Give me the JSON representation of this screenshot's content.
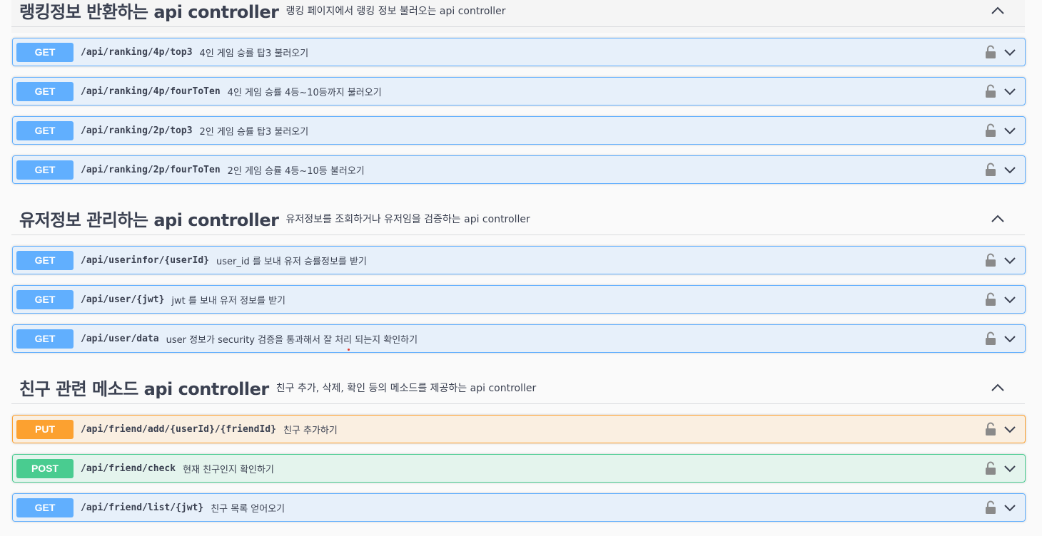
{
  "sections": [
    {
      "title": "랭킹정보 반환하는 api controller",
      "description": "랭킹 페이지에서 랭킹 정보 불러오는 api controller",
      "operations": [
        {
          "method": "GET",
          "path": "/api/ranking/4p/top3",
          "summary": "4인 게임 승률 탑3 불러오기"
        },
        {
          "method": "GET",
          "path": "/api/ranking/4p/fourToTen",
          "summary": "4인 게임 승률 4등~10등까지 불러오기"
        },
        {
          "method": "GET",
          "path": "/api/ranking/2p/top3",
          "summary": "2인 게임 승률 탑3 불러오기"
        },
        {
          "method": "GET",
          "path": "/api/ranking/2p/fourToTen",
          "summary": "2인 게임 승률 4등~10등 불러오기"
        }
      ]
    },
    {
      "title": "유저정보 관리하는 api controller",
      "description": "유저정보를 조회하거나 유저임을 검증하는 api controller",
      "operations": [
        {
          "method": "GET",
          "path": "/api/userinfor/{userId}",
          "summary": "user_id 를 보내 유저 승률정보를 받기"
        },
        {
          "method": "GET",
          "path": "/api/user/{jwt}",
          "summary": "jwt 를 보내 유저 정보를 받기"
        },
        {
          "method": "GET",
          "path": "/api/user/data",
          "summary": "user 정보가 security 검증을 통과해서 잘 처리 되는지 확인하기"
        }
      ]
    },
    {
      "title": "친구 관련 메소드 api controller",
      "description": "친구 추가, 삭제, 확인 등의 메소드를 제공하는 api controller",
      "operations": [
        {
          "method": "PUT",
          "path": "/api/friend/add/{userId}/{friendId}",
          "summary": "친구 추가하기"
        },
        {
          "method": "POST",
          "path": "/api/friend/check",
          "summary": "현재 친구인지 확인하기"
        },
        {
          "method": "GET",
          "path": "/api/friend/list/{jwt}",
          "summary": "친구 목록 얻어오기"
        }
      ]
    }
  ],
  "icons": {
    "collapse": "chevron-up-icon",
    "expand": "chevron-down-icon",
    "auth": "lock-icon"
  },
  "colors": {
    "get": "#61affe",
    "put": "#fca130",
    "post": "#49cc90",
    "text": "#3b4151"
  }
}
